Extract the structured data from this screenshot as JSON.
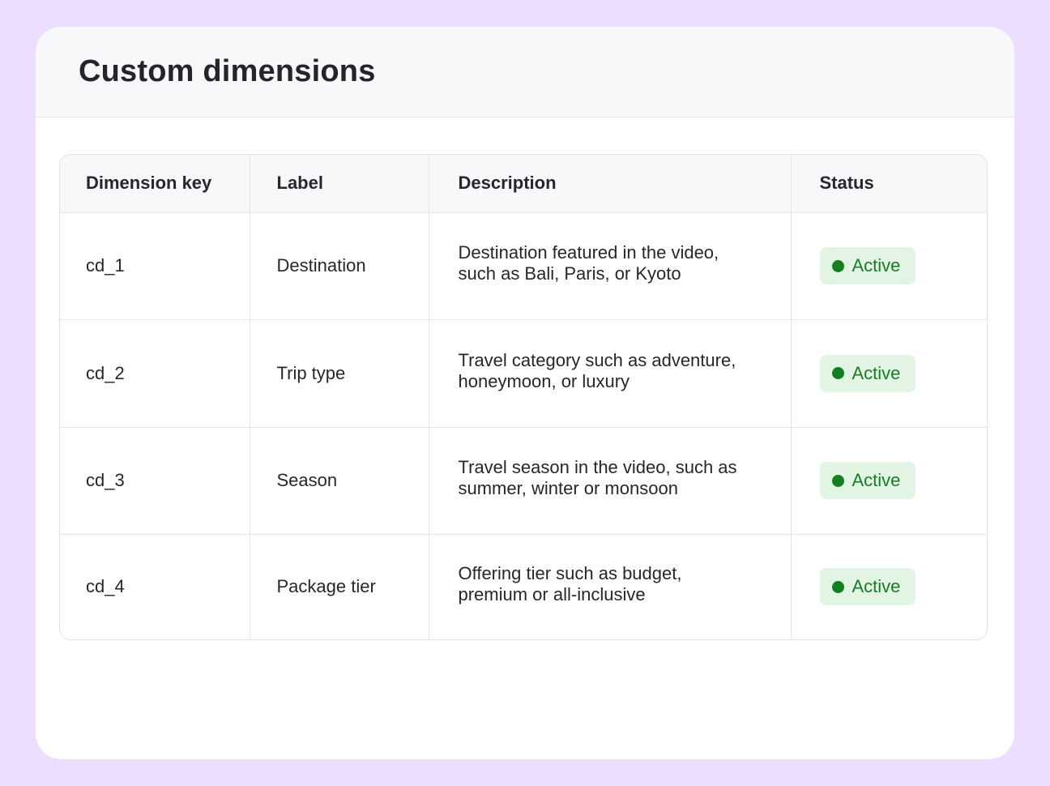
{
  "card": {
    "title": "Custom dimensions"
  },
  "table": {
    "headers": [
      "Dimension key",
      "Label",
      "Description",
      "Status"
    ],
    "rows": [
      {
        "key": "cd_1",
        "label": "Destination",
        "description_line1": "Destination featured in the video,",
        "description_line2": "such as Bali, Paris, or Kyoto",
        "status": "Active"
      },
      {
        "key": "cd_2",
        "label": "Trip type",
        "description_line1": "Travel category such as adventure,",
        "description_line2": "honeymoon, or luxury",
        "status": "Active"
      },
      {
        "key": "cd_3",
        "label": "Season",
        "description_line1": "Travel season in the video, such as",
        "description_line2": "summer, winter or monsoon",
        "status": "Active"
      },
      {
        "key": "cd_4",
        "label": "Package tier",
        "description_line1": "Offering tier such as budget,",
        "description_line2": "premium or all-inclusive",
        "status": "Active"
      }
    ]
  },
  "colors": {
    "page_background": "#ebdeff",
    "status_active_bg": "#e2f5e5",
    "status_active_text": "#1b7a25",
    "status_active_dot": "#12801e"
  },
  "icons": {
    "status_indicator": "status-dot-icon"
  }
}
